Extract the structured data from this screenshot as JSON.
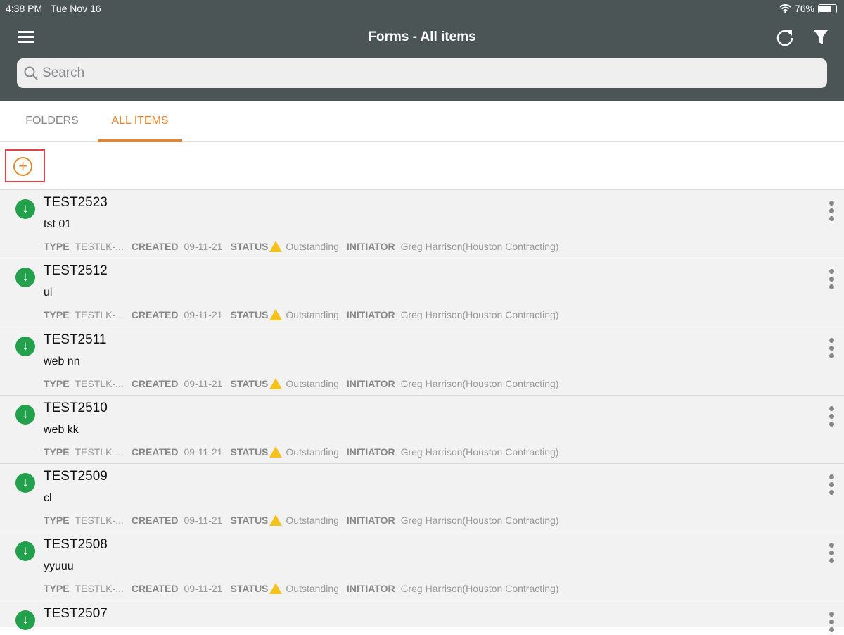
{
  "status_bar": {
    "time": "4:38 PM",
    "date": "Tue Nov 16",
    "battery": "76%",
    "battery_level": 0.76
  },
  "header": {
    "title": "Forms - All items"
  },
  "search": {
    "placeholder": "Search"
  },
  "tabs": [
    {
      "label": "FOLDERS",
      "active": false
    },
    {
      "label": "ALL ITEMS",
      "active": true
    }
  ],
  "labels": {
    "type": "TYPE",
    "created": "CREATED",
    "status": "STATUS",
    "initiator": "INITIATOR"
  },
  "items": [
    {
      "id": "TEST2523",
      "subtitle": "tst 01",
      "type": "TESTLK-...",
      "created": "09-11-21",
      "status": "Outstanding",
      "initiator": "Greg Harrison(Houston Contracting)"
    },
    {
      "id": "TEST2512",
      "subtitle": "ui",
      "type": "TESTLK-...",
      "created": "09-11-21",
      "status": "Outstanding",
      "initiator": "Greg Harrison(Houston Contracting)"
    },
    {
      "id": "TEST2511",
      "subtitle": "web nn",
      "type": "TESTLK-...",
      "created": "09-11-21",
      "status": "Outstanding",
      "initiator": "Greg Harrison(Houston Contracting)"
    },
    {
      "id": "TEST2510",
      "subtitle": "web kk",
      "type": "TESTLK-...",
      "created": "09-11-21",
      "status": "Outstanding",
      "initiator": "Greg Harrison(Houston Contracting)"
    },
    {
      "id": "TEST2509",
      "subtitle": "cl",
      "type": "TESTLK-...",
      "created": "09-11-21",
      "status": "Outstanding",
      "initiator": "Greg Harrison(Houston Contracting)"
    },
    {
      "id": "TEST2508",
      "subtitle": "yyuuu",
      "type": "TESTLK-...",
      "created": "09-11-21",
      "status": "Outstanding",
      "initiator": "Greg Harrison(Houston Contracting)"
    },
    {
      "id": "TEST2507"
    }
  ]
}
